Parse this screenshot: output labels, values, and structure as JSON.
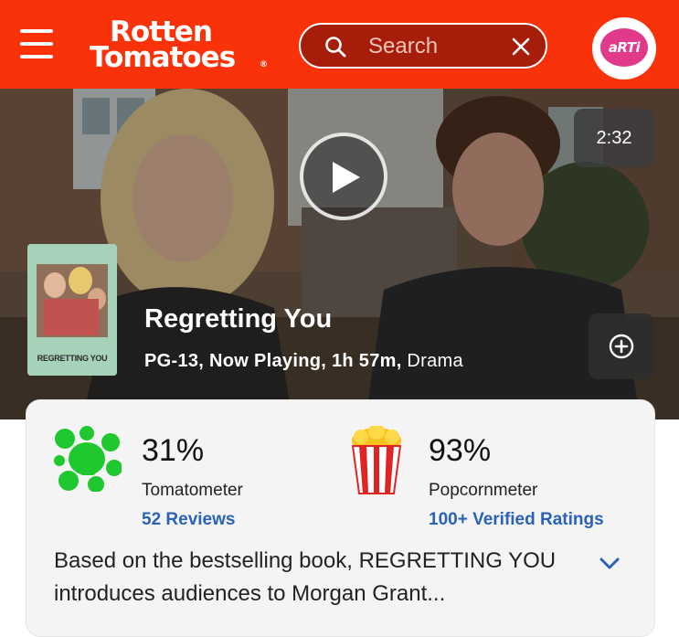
{
  "header": {
    "logo_line1": "Rotten",
    "logo_line2": "Tomatoes",
    "logo_mark": "®",
    "search_placeholder": "Search",
    "avatar_text": "aRTi",
    "bg_color": "#fa320a"
  },
  "hero": {
    "duration": "2:32",
    "poster_title": "REGRETTING YOU",
    "title": "Regretting You",
    "rating": "PG-13,",
    "status": "Now Playing,",
    "runtime": "1h 57m,",
    "genre": "Drama"
  },
  "scores": {
    "tomatometer": {
      "value": "31%",
      "label": "Tomatometer",
      "link": "52 Reviews",
      "icon": "green-splat-icon"
    },
    "popcornmeter": {
      "value": "93%",
      "label": "Popcornmeter",
      "link": "100+ Verified Ratings",
      "icon": "popcorn-bucket-icon"
    },
    "link_color": "#2a62b8"
  },
  "synopsis": {
    "text": "Based on the bestselling book, REGRETTING YOU introduces audiences to Morgan Grant..."
  },
  "icons": {
    "menu": "hamburger-menu-icon",
    "search": "search-icon",
    "clear": "close-icon",
    "play": "play-icon",
    "add": "plus-circle-icon",
    "expand": "chevron-down-icon"
  }
}
